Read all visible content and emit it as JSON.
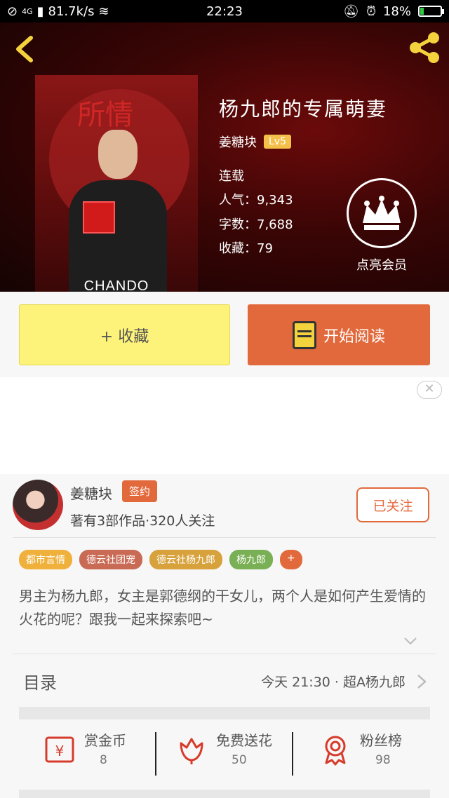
{
  "status_bar": {
    "network": "4G",
    "speed": "81.7k/s",
    "time": "22:23",
    "battery": "18%",
    "battery_level": 0.18
  },
  "book": {
    "title": "杨九郎的专属萌妻",
    "author": "姜糖块",
    "level": "Lv5",
    "status": "连载",
    "popularity": "人气：9,343",
    "word_count": "字数：7,688",
    "favorites": "收藏：79",
    "cover_brand": "CHANDO",
    "cover_calligraphy": "所情"
  },
  "vip": {
    "label": "点亮会员"
  },
  "actions": {
    "collect_label": "+ 收藏",
    "read_label": "开始阅读"
  },
  "ad": {
    "close_label": "✕"
  },
  "author": {
    "name": "姜糖块",
    "signed": "签约",
    "info": "著有3部作品·320人关注",
    "follow_label": "已关注"
  },
  "tags": [
    {
      "label": "都市言情",
      "color": "#f0b13c"
    },
    {
      "label": "德云社团宠",
      "color": "#c96a55"
    },
    {
      "label": "德云社杨九郎",
      "color": "#d7a23c"
    },
    {
      "label": "杨九郎",
      "color": "#7ab055"
    },
    {
      "label": "+",
      "color": "#e2693c"
    }
  ],
  "description": "男主为杨九郎，女主是郭德纲的干女儿，两个人是如何产生爱情的火花的呢？跟我一起来探索吧~",
  "toc": {
    "label": "目录",
    "latest": "今天 21:30 · 超A杨九郎"
  },
  "stats": [
    {
      "name": "赏金币",
      "value": "8"
    },
    {
      "name": "免费送花",
      "value": "50"
    },
    {
      "name": "粉丝榜",
      "value": "98"
    }
  ],
  "colors": {
    "accent": "#e2693c",
    "collect_bg": "#fdf27a",
    "header_bg": "#3a0505"
  }
}
